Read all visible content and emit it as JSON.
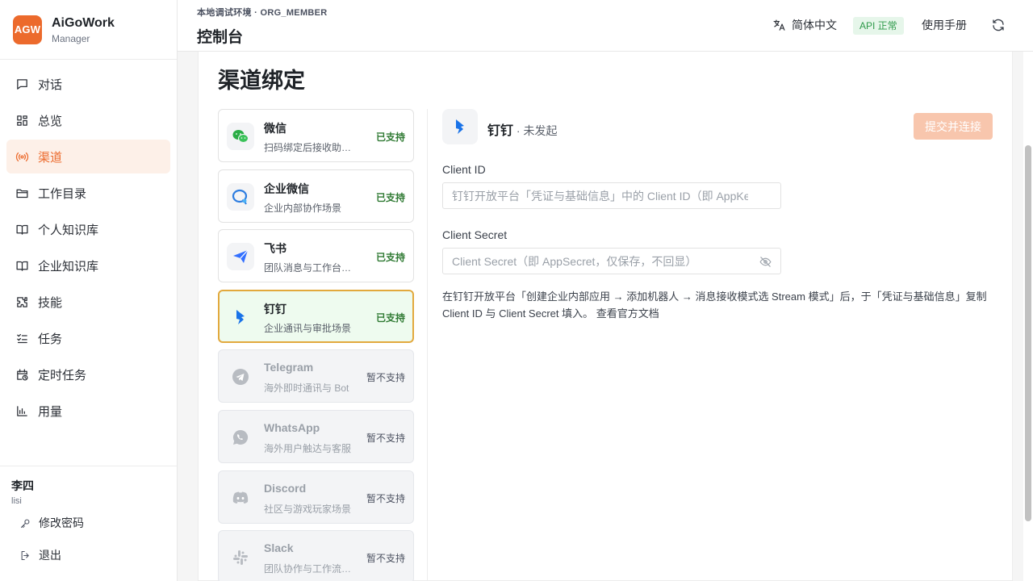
{
  "brand": {
    "logo_text": "AGW",
    "name": "AiGoWork",
    "role": "Manager",
    "logo_color": "#ec6a2c"
  },
  "nav": {
    "items": [
      {
        "label": "对话",
        "icon": "chat-icon"
      },
      {
        "label": "总览",
        "icon": "grid-icon"
      },
      {
        "label": "渠道",
        "icon": "broadcast-icon",
        "active": true
      },
      {
        "label": "工作目录",
        "icon": "folder-icon"
      },
      {
        "label": "个人知识库",
        "icon": "book-icon"
      },
      {
        "label": "企业知识库",
        "icon": "book-icon"
      },
      {
        "label": "技能",
        "icon": "puzzle-icon"
      },
      {
        "label": "任务",
        "icon": "checklist-icon"
      },
      {
        "label": "定时任务",
        "icon": "calendar-clock-icon"
      },
      {
        "label": "用量",
        "icon": "bar-chart-icon"
      }
    ]
  },
  "user": {
    "name": "李四",
    "id": "lisi",
    "change_password": "修改密码",
    "logout": "退出"
  },
  "header": {
    "env": "本地调试环境 · ORG_MEMBER",
    "title": "控制台",
    "language": "简体中文",
    "api_status": "API 正常",
    "manual": "使用手册"
  },
  "main": {
    "title": "渠道绑定",
    "channels": [
      {
        "name": "微信",
        "desc": "扫码绑定后接收助手消息",
        "status": "已支持",
        "icon": "wechat-icon"
      },
      {
        "name": "企业微信",
        "desc": "企业内部协作场景",
        "status": "已支持",
        "icon": "wecom-icon"
      },
      {
        "name": "飞书",
        "desc": "团队消息与工作台通知",
        "status": "已支持",
        "icon": "feishu-icon"
      },
      {
        "name": "钉钉",
        "desc": "企业通讯与审批场景",
        "status": "已支持",
        "icon": "dingtalk-icon",
        "selected": true
      },
      {
        "name": "Telegram",
        "desc": "海外即时通讯与 Bot",
        "status": "暂不支持",
        "icon": "telegram-icon",
        "disabled": true
      },
      {
        "name": "WhatsApp",
        "desc": "海外用户触达与客服",
        "status": "暂不支持",
        "icon": "whatsapp-icon",
        "disabled": true
      },
      {
        "name": "Discord",
        "desc": "社区与游戏玩家场景",
        "status": "暂不支持",
        "icon": "discord-icon",
        "disabled": true
      },
      {
        "name": "Slack",
        "desc": "团队协作与工作流通知",
        "status": "暂不支持",
        "icon": "slack-icon",
        "disabled": true
      }
    ],
    "detail": {
      "name": "钉钉",
      "state": " · 未发起",
      "submit": "提交并连接",
      "client_id_label": "Client ID",
      "client_id_placeholder": "钉钉开放平台「凭证与基础信息」中的 Client ID（即 AppKey）",
      "client_secret_label": "Client Secret",
      "client_secret_placeholder": "Client Secret（即 AppSecret，仅保存，不回显）",
      "help": "在钉钉开放平台「创建企业内部应用 → 添加机器人 → 消息接收模式选 Stream 模式」后，于「凭证与基础信息」复制 Client ID 与 Client Secret 填入。",
      "doc_link": "查看官方文档"
    }
  },
  "colors": {
    "accent": "#ec6a2c",
    "supported": "#2f7a33",
    "selected_border": "#e2a93d",
    "api_ok": "#2f9a4b"
  }
}
